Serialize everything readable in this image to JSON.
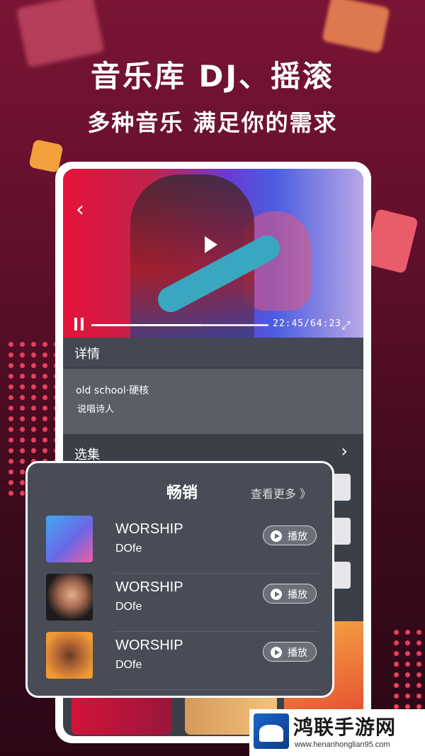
{
  "headline": {
    "line1": "音乐库 DJ、摇滚",
    "line2": "多种音乐 满足你的需求"
  },
  "player": {
    "back_icon": "‹",
    "time": "22:45/64:23",
    "fullscreen_icon": "⤢",
    "progress": 0.62
  },
  "details": {
    "section_label": "详情",
    "title": "old school·硬核",
    "artist": "说唱诗人"
  },
  "episodes": {
    "section_label": "选集",
    "chevron": "›"
  },
  "card": {
    "title": "畅销",
    "more_label": "查看更多 》",
    "play_label": "播放",
    "items": [
      {
        "name": "WORSHIP",
        "artist": "DOfe"
      },
      {
        "name": "WORSHIP",
        "artist": "DOfe"
      },
      {
        "name": "WORSHIP",
        "artist": "DOfe"
      }
    ]
  },
  "watermark": {
    "text": "鸿联手游网",
    "url": "www.henanhonglian95.com"
  }
}
